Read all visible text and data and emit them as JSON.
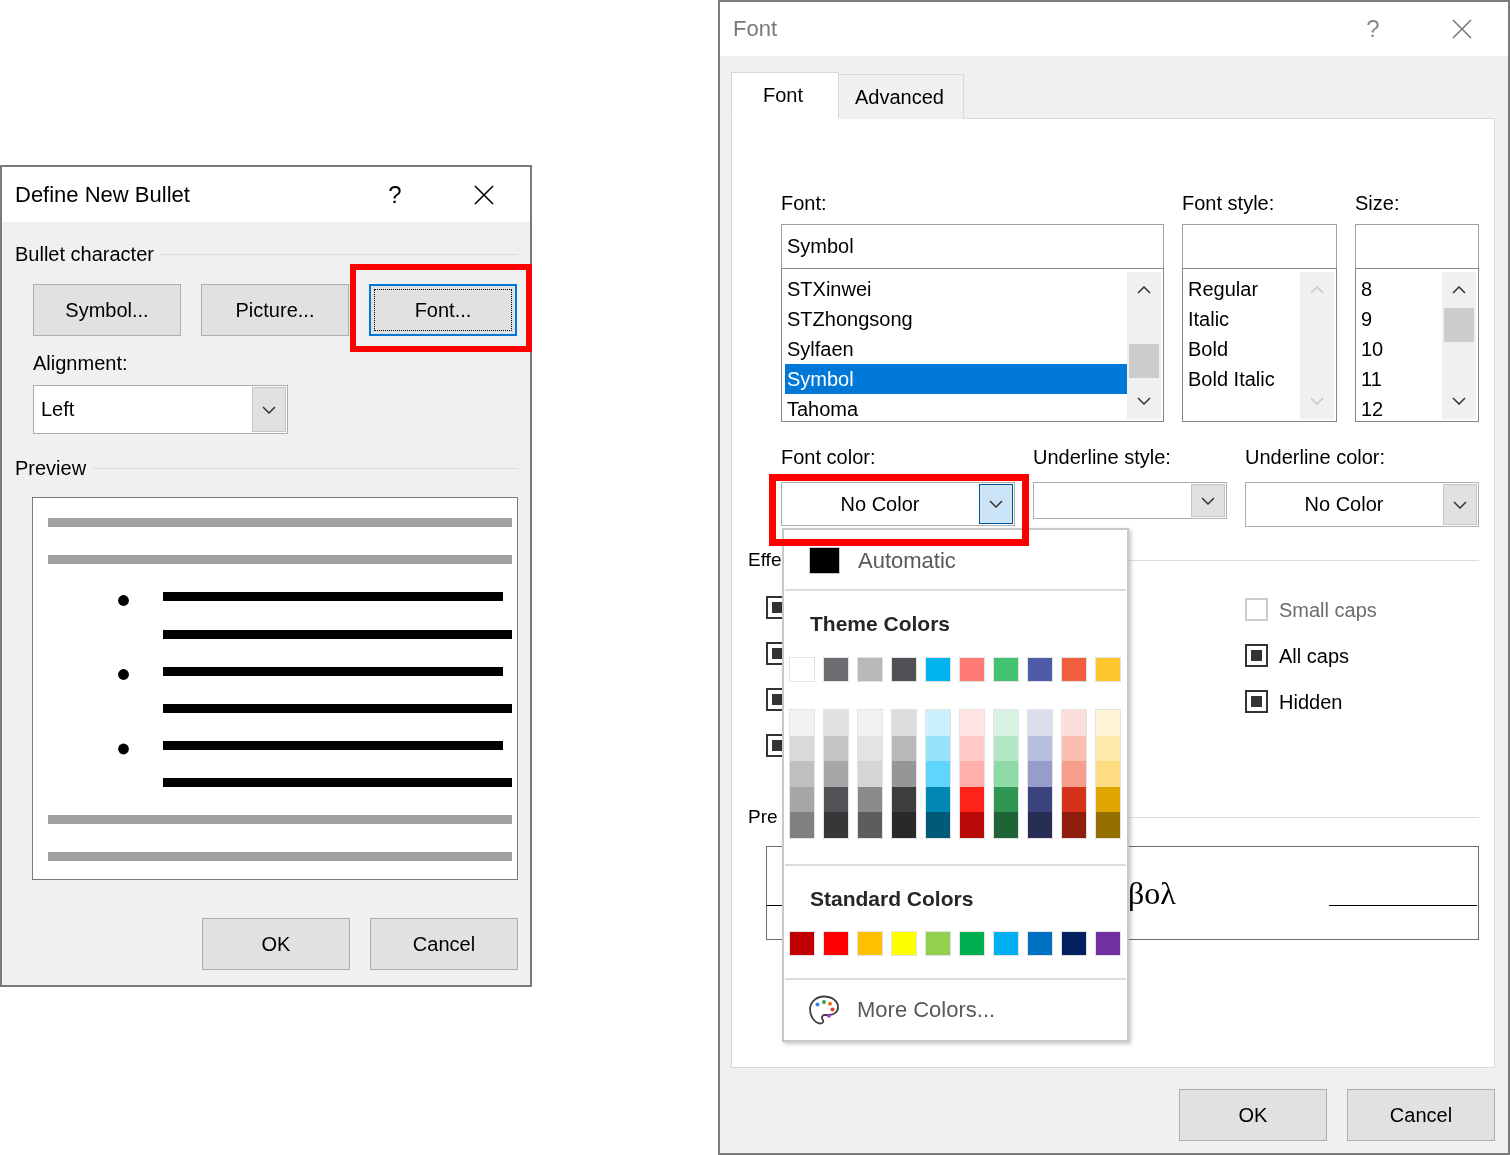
{
  "define_new_bullet": {
    "title": "Define New Bullet",
    "active": true,
    "help": "?",
    "bullet_character": {
      "heading": "Bullet character",
      "buttons": [
        {
          "label": "Symbol...",
          "focused": false,
          "highlighted": false
        },
        {
          "label": "Picture...",
          "focused": false,
          "highlighted": false
        },
        {
          "label": "Font...",
          "focused": true,
          "highlighted": true
        }
      ]
    },
    "alignment": {
      "label": "Alignment:",
      "value": "Left"
    },
    "preview": {
      "heading": "Preview"
    },
    "buttons": [
      {
        "label": "OK"
      },
      {
        "label": "Cancel"
      }
    ]
  },
  "font_dialog": {
    "title": "Font",
    "active": false,
    "help": "?",
    "tabs": [
      {
        "label": "Font",
        "selected": true
      },
      {
        "label": "Advanced",
        "selected": false
      }
    ],
    "font": {
      "label": "Font:",
      "value": "Symbol",
      "scrollable": true,
      "items": [
        {
          "label": "STXinwei",
          "selected": false
        },
        {
          "label": "STZhongsong",
          "selected": false
        },
        {
          "label": "Sylfaen",
          "selected": false
        },
        {
          "label": "Symbol",
          "selected": true
        },
        {
          "label": "Tahoma",
          "selected": false
        }
      ]
    },
    "font_style": {
      "label": "Font style:",
      "scrollable": false,
      "items": [
        {
          "label": "Regular",
          "selected": false
        },
        {
          "label": "Italic",
          "selected": false
        },
        {
          "label": "Bold",
          "selected": false
        },
        {
          "label": "Bold Italic",
          "selected": false
        }
      ]
    },
    "size": {
      "label": "Size:",
      "scrollable": true,
      "items": [
        {
          "label": "8",
          "selected": false
        },
        {
          "label": "9",
          "selected": false
        },
        {
          "label": "10",
          "selected": false
        },
        {
          "label": "11",
          "selected": false
        },
        {
          "label": "12",
          "selected": false
        }
      ]
    },
    "font_color": {
      "label": "Font color:",
      "value": "No Color",
      "open": true,
      "highlighted": true,
      "menu": {
        "automatic": {
          "label": "Automatic",
          "color": "#000000"
        },
        "theme_heading": "Theme Colors",
        "theme_colors": [
          {
            "color": "#ffffff",
            "shades": [
              {
                "color": "#f2f2f2"
              },
              {
                "color": "#d9d9d9"
              },
              {
                "color": "#bfbfbf"
              },
              {
                "color": "#a6a6a6"
              },
              {
                "color": "#808080"
              }
            ]
          },
          {
            "color": "#6d6e72",
            "shades": [
              {
                "color": "#e2e2e3"
              },
              {
                "color": "#c4c4c6"
              },
              {
                "color": "#a7a7aa"
              },
              {
                "color": "#525356"
              },
              {
                "color": "#363739"
              }
            ]
          },
          {
            "color": "#b8b9bb",
            "shades": [
              {
                "color": "#f1f1f2"
              },
              {
                "color": "#e3e3e4"
              },
              {
                "color": "#d4d5d6"
              },
              {
                "color": "#898a8c"
              },
              {
                "color": "#5c5d5e"
              }
            ]
          },
          {
            "color": "#505154",
            "shades": [
              {
                "color": "#dcdcdd"
              },
              {
                "color": "#b9b9bb"
              },
              {
                "color": "#969698"
              },
              {
                "color": "#3c3d3f"
              },
              {
                "color": "#28292a"
              }
            ]
          },
          {
            "color": "#00b5ef",
            "shades": [
              {
                "color": "#ccf0fc"
              },
              {
                "color": "#99e3fa"
              },
              {
                "color": "#5fd5fb"
              },
              {
                "color": "#0087b3"
              },
              {
                "color": "#005a78"
              }
            ]
          },
          {
            "color": "#ff7b73",
            "shades": [
              {
                "color": "#ffe4e2"
              },
              {
                "color": "#ffcac7"
              },
              {
                "color": "#ffafab"
              },
              {
                "color": "#ff2219"
              },
              {
                "color": "#b90a08"
              }
            ]
          },
          {
            "color": "#43c370",
            "shades": [
              {
                "color": "#d9f3e2"
              },
              {
                "color": "#b3e7c5"
              },
              {
                "color": "#8edba8"
              },
              {
                "color": "#2f9654"
              },
              {
                "color": "#1f6438"
              }
            ]
          },
          {
            "color": "#505ba8",
            "shades": [
              {
                "color": "#dcdeee"
              },
              {
                "color": "#b9bddc"
              },
              {
                "color": "#969dcb"
              },
              {
                "color": "#3b447e"
              },
              {
                "color": "#282d54"
              }
            ]
          },
          {
            "color": "#f15d3d",
            "shades": [
              {
                "color": "#fcdeda"
              },
              {
                "color": "#f9beb2"
              },
              {
                "color": "#f69d8b"
              },
              {
                "color": "#d6311b"
              },
              {
                "color": "#8f1e0c"
              }
            ]
          },
          {
            "color": "#fec52e",
            "shades": [
              {
                "color": "#fff3d5"
              },
              {
                "color": "#fee8ab"
              },
              {
                "color": "#fedd82"
              },
              {
                "color": "#e0a500"
              },
              {
                "color": "#956e00"
              }
            ]
          }
        ],
        "standard_heading": "Standard Colors",
        "standard_colors": [
          {
            "color": "#c00000"
          },
          {
            "color": "#ff0000"
          },
          {
            "color": "#ffc000"
          },
          {
            "color": "#ffff00"
          },
          {
            "color": "#92d050"
          },
          {
            "color": "#00b050"
          },
          {
            "color": "#00b0f0"
          },
          {
            "color": "#0070c0"
          },
          {
            "color": "#002060"
          },
          {
            "color": "#7030a0"
          }
        ],
        "more_colors": {
          "label": "More Colors..."
        }
      }
    },
    "underline_style": {
      "label": "Underline style:",
      "open": false
    },
    "underline_color": {
      "label": "Underline color:",
      "value": "No Color",
      "open": false
    },
    "effects": {
      "heading": "Effe",
      "left_options": [
        {
          "indeterminate": true,
          "disabled": false
        },
        {
          "indeterminate": true,
          "disabled": false
        },
        {
          "indeterminate": true,
          "disabled": false
        },
        {
          "indeterminate": true,
          "disabled": false
        }
      ],
      "right_options": [
        {
          "label": "Small caps",
          "indeterminate": false,
          "disabled": true
        },
        {
          "label": "All caps",
          "indeterminate": true,
          "disabled": false
        },
        {
          "label": "Hidden",
          "indeterminate": true,
          "disabled": false
        }
      ]
    },
    "preview": {
      "heading": "Pre",
      "sample": "βολ"
    },
    "buttons": [
      {
        "label": "OK"
      },
      {
        "label": "Cancel"
      }
    ]
  }
}
